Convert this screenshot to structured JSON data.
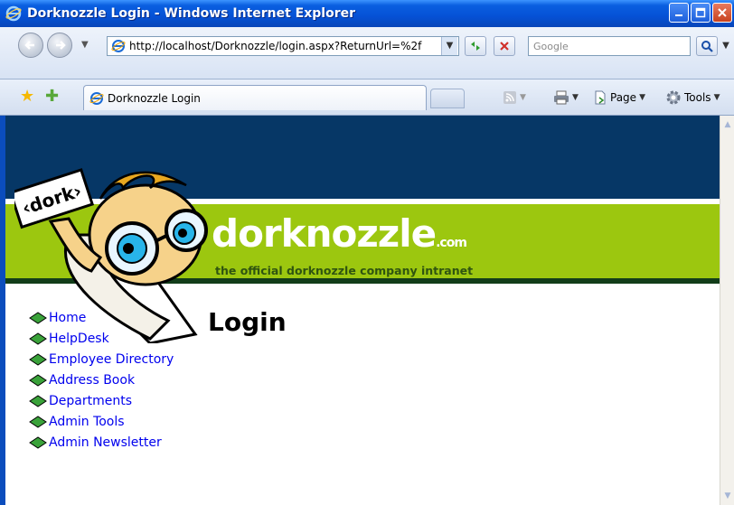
{
  "window": {
    "title": "Dorknozzle Login - Windows Internet Explorer"
  },
  "address_bar": {
    "url": "http://localhost/Dorknozzle/login.aspx?ReturnUrl=%2f"
  },
  "search": {
    "placeholder": "Google"
  },
  "tab": {
    "label": "Dorknozzle Login"
  },
  "commands": {
    "page": "Page",
    "tools": "Tools"
  },
  "header": {
    "brand": "dorknozzle",
    "brand_suffix": ".com",
    "tagline": "the official dorknozzle company intranet",
    "sign_text": "‹dork›"
  },
  "menu": [
    {
      "label": "Home"
    },
    {
      "label": "HelpDesk"
    },
    {
      "label": "Employee Directory"
    },
    {
      "label": "Address Book"
    },
    {
      "label": "Departments"
    },
    {
      "label": "Admin Tools"
    },
    {
      "label": "Admin Newsletter"
    }
  ],
  "page": {
    "heading": "Login"
  },
  "colors": {
    "header_navy": "#063766",
    "header_green": "#9cc70f",
    "link_blue": "#0000ee"
  }
}
